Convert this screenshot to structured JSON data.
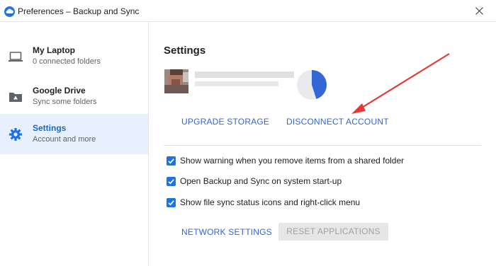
{
  "window": {
    "title": "Preferences – Backup and Sync",
    "app_icon": "backup-sync-cloud-icon",
    "close_icon": "close-icon"
  },
  "sidebar": {
    "items": [
      {
        "label": "My Laptop",
        "sub": "0 connected folders",
        "icon": "laptop-icon",
        "active": false
      },
      {
        "label": "Google Drive",
        "sub": "Sync some folders",
        "icon": "drive-folder-icon",
        "active": false
      },
      {
        "label": "Settings",
        "sub": "Account and more",
        "icon": "gear-icon",
        "active": true
      }
    ]
  },
  "main": {
    "title": "Settings",
    "storage_used_fraction": 0.45,
    "upgrade_label": "UPGRADE STORAGE",
    "disconnect_label": "DISCONNECT ACCOUNT",
    "options": [
      {
        "label": "Show warning when you remove items from a shared folder",
        "checked": true
      },
      {
        "label": "Open Backup and Sync on system start-up",
        "checked": true
      },
      {
        "label": "Show file sync status icons and right-click menu",
        "checked": true
      }
    ],
    "network_label": "NETWORK SETTINGS",
    "reset_label": "RESET APPLICATIONS"
  },
  "colors": {
    "accent": "#1a73e8",
    "link": "#3367d6",
    "active_bg": "#e8f0fe",
    "annotation_arrow": "#e53935"
  }
}
